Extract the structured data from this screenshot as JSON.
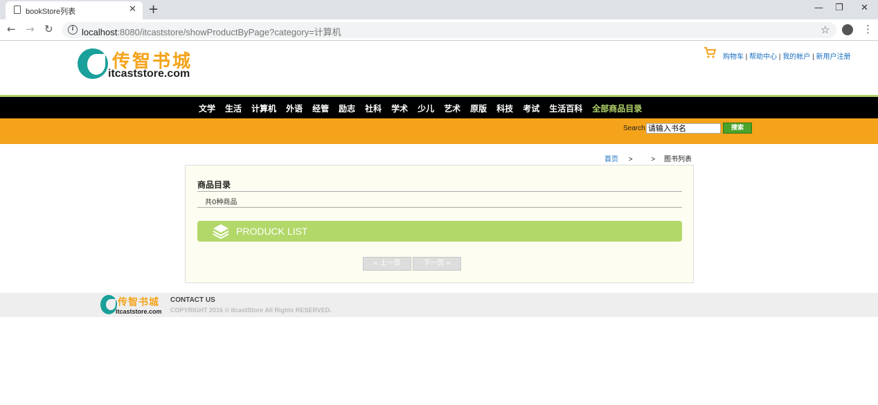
{
  "browser": {
    "tab_title": "bookStore列表",
    "url_host": "localhost",
    "url_rest": ":8080/itcaststore/showProductByPage?category=计算机"
  },
  "header": {
    "logo_cn": "传智书城",
    "logo_en": "itcaststore.com",
    "links": [
      "购物车",
      "帮助中心",
      "我的帐户",
      "新用户注册"
    ]
  },
  "nav": {
    "items": [
      "文学",
      "生活",
      "计算机",
      "外语",
      "经管",
      "励志",
      "社科",
      "学术",
      "少儿",
      "艺术",
      "原版",
      "科技",
      "考试",
      "生活百科"
    ],
    "all_label": "全部商品目录"
  },
  "search": {
    "label": "Search",
    "placeholder": "请输入书名",
    "button": "搜索"
  },
  "breadcrumb": {
    "home": "首页",
    "sep1": ">",
    "sep2": ">",
    "current": "图书列表"
  },
  "catalog": {
    "title": "商品目录",
    "count": "共0种商品",
    "list_label": "PRODUCK LIST",
    "prev": "上一页",
    "next": "下一页"
  },
  "footer": {
    "logo_cn": "传智书城",
    "logo_en": "itcaststore.com",
    "contact": "CONTACT US",
    "copyright": "COPYRIGHT 2016 © ItcastStore All Rights RESERVED."
  }
}
